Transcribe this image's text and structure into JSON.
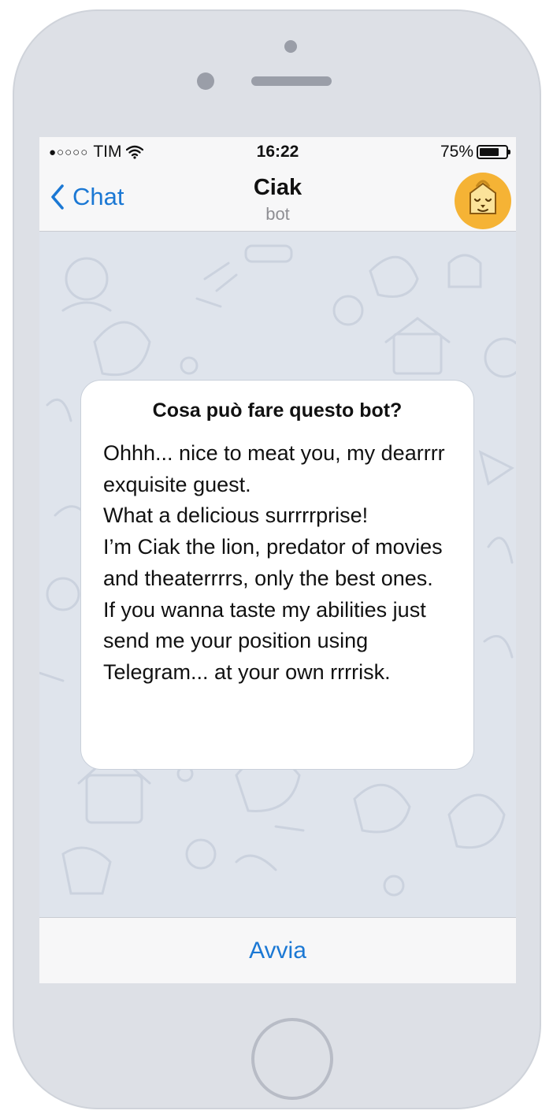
{
  "status_bar": {
    "signal": "●○○○○",
    "carrier": "TIM",
    "time": "16:22",
    "battery_text": "75%",
    "battery_level": 0.75
  },
  "nav": {
    "back_label": "Chat",
    "title": "Ciak",
    "subtitle": "bot"
  },
  "bot_info": {
    "title": "Cosa può fare questo bot?",
    "lines": [
      "Ohhh... nice to meat you, my dearrrr exquisite guest.",
      "What a delicious surrrrprise!",
      "I’m Ciak the lion, predator of movies and theaterrrrs, only the best ones.",
      "If you wanna taste my abilities just send me your position using Telegram... at your own rrrrisk."
    ]
  },
  "start_button": {
    "label": "Avvia"
  },
  "colors": {
    "accent": "#1b78d4",
    "wallpaper": "#dfe4ec",
    "avatar_bg": "#f5b335",
    "device_body": "#dde0e6"
  },
  "icons": {
    "back": "chevron-left-icon",
    "wifi": "wifi-icon",
    "battery": "battery-icon",
    "avatar": "lion-avatar-icon"
  }
}
